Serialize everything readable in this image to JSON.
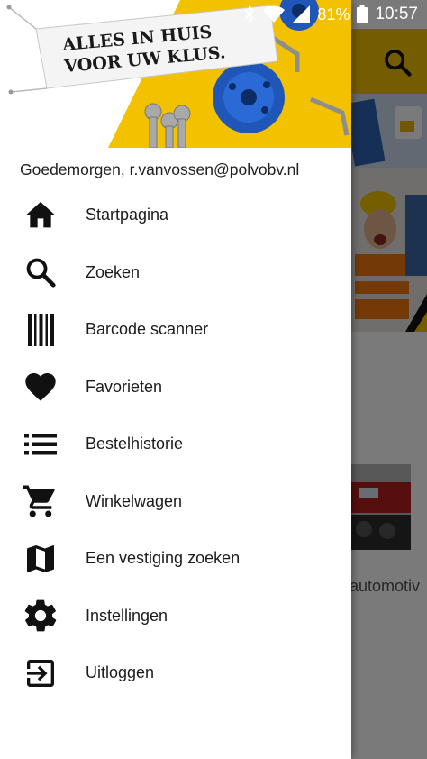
{
  "status_bar": {
    "battery_percent": "81%",
    "time": "10:57",
    "icons": [
      "bluetooth-icon",
      "wifi-icon",
      "signal-icon",
      "battery-icon"
    ]
  },
  "background_app": {
    "partial_text": "automotiv"
  },
  "drawer": {
    "header_banner": {
      "line1": "ALLES IN HUIS",
      "line2": "VOOR UW KLUS."
    },
    "greeting": "Goedemorgen, r.vanvossen@polvobv.nl",
    "menu": [
      {
        "label": "Startpagina",
        "icon": "home-icon"
      },
      {
        "label": "Zoeken",
        "icon": "search-icon"
      },
      {
        "label": "Barcode scanner",
        "icon": "barcode-icon"
      },
      {
        "label": "Favorieten",
        "icon": "heart-icon"
      },
      {
        "label": "Bestelhistorie",
        "icon": "list-icon"
      },
      {
        "label": "Winkelwagen",
        "icon": "cart-icon"
      },
      {
        "label": "Een vestiging zoeken",
        "icon": "map-icon"
      },
      {
        "label": "Instellingen",
        "icon": "gear-icon"
      },
      {
        "label": "Uitloggen",
        "icon": "logout-icon"
      }
    ]
  },
  "colors": {
    "brand_yellow": "#f2c200",
    "drawer_bg": "#ffffff",
    "text": "#1c1c1c"
  }
}
